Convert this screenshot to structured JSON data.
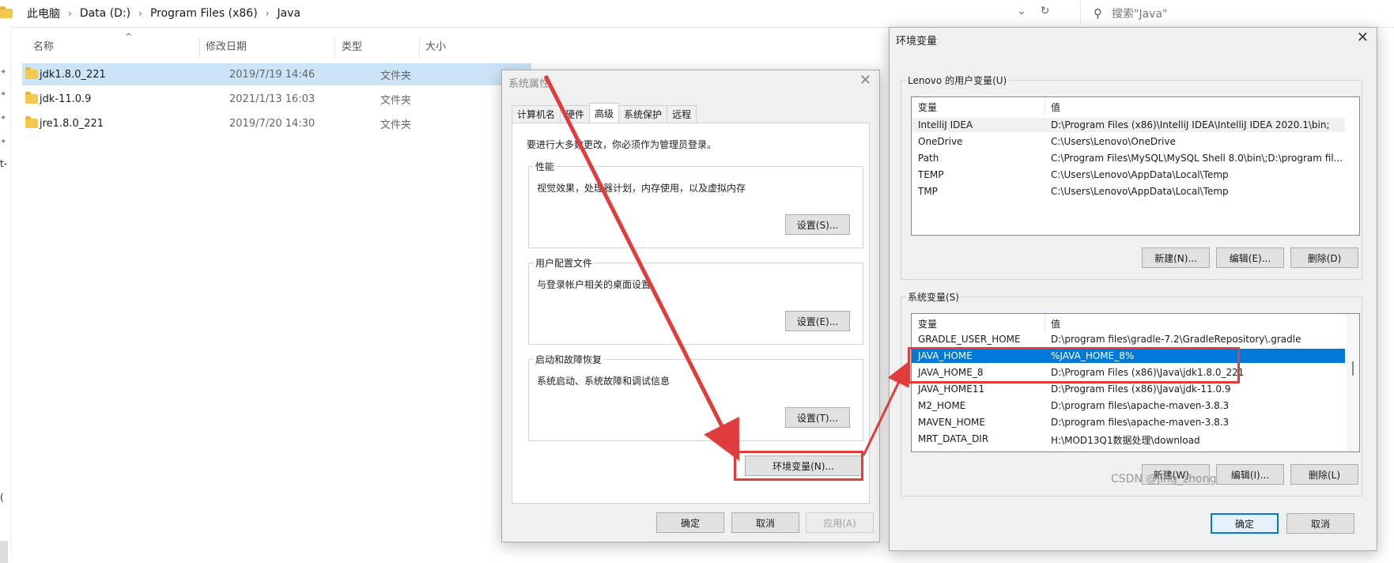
{
  "explorer": {
    "breadcrumbs": [
      "此电脑",
      "Data (D:)",
      "Program Files (x86)",
      "Java"
    ],
    "search_placeholder": "搜索\"Java\"",
    "columns": [
      "名称",
      "修改日期",
      "类型",
      "大小"
    ],
    "files": [
      {
        "name": "jdk1.8.0_221",
        "date": "2019/7/19 14:46",
        "type": "文件夹"
      },
      {
        "name": "jdk-11.0.9",
        "date": "2021/1/13 16:03",
        "type": "文件夹"
      },
      {
        "name": "jre1.8.0_221",
        "date": "2019/7/20 14:30",
        "type": "文件夹"
      }
    ],
    "leftnav_fragments": [
      "t-",
      "("
    ]
  },
  "system_properties": {
    "title": "系统属性",
    "tabs": [
      "计算机名",
      "硬件",
      "高级",
      "系统保护",
      "远程"
    ],
    "admin_note": "要进行大多数更改，你必须作为管理员登录。",
    "performance": {
      "title": "性能",
      "desc": "视觉效果，处理器计划，内存使用，以及虚拟内存",
      "button": "设置(S)..."
    },
    "user_profiles": {
      "title": "用户配置文件",
      "desc": "与登录帐户相关的桌面设置",
      "button": "设置(E)..."
    },
    "startup": {
      "title": "启动和故障恢复",
      "desc": "系统启动、系统故障和调试信息",
      "button": "设置(T)..."
    },
    "env_button": "环境变量(N)...",
    "ok": "确定",
    "cancel": "取消",
    "apply": "应用(A)"
  },
  "env_vars": {
    "title": "环境变量",
    "user_group": "Lenovo 的用户变量(U)",
    "col_var": "变量",
    "col_val": "值",
    "user_vars": [
      {
        "name": "IntelliJ IDEA",
        "value": "D:\\Program Files (x86)\\IntelliJ IDEA\\IntelliJ IDEA 2020.1\\bin;"
      },
      {
        "name": "OneDrive",
        "value": "C:\\Users\\Lenovo\\OneDrive"
      },
      {
        "name": "Path",
        "value": "C:\\Program Files\\MySQL\\MySQL Shell 8.0\\bin\\;D:\\program fil..."
      },
      {
        "name": "TEMP",
        "value": "C:\\Users\\Lenovo\\AppData\\Local\\Temp"
      },
      {
        "name": "TMP",
        "value": "C:\\Users\\Lenovo\\AppData\\Local\\Temp"
      }
    ],
    "user_buttons": {
      "new": "新建(N)...",
      "edit": "编辑(E)...",
      "delete": "删除(D)"
    },
    "system_group": "系统变量(S)",
    "system_vars": [
      {
        "name": "GRADLE_USER_HOME",
        "value": "D:\\program files\\gradle-7.2\\GradleRepository\\.gradle"
      },
      {
        "name": "JAVA_HOME",
        "value": "%JAVA_HOME_8%"
      },
      {
        "name": "JAVA_HOME_8",
        "value": "D:\\Program Files (x86)\\Java\\jdk1.8.0_221"
      },
      {
        "name": "JAVA_HOME11",
        "value": "D:\\Program Files (x86)\\Java\\jdk-11.0.9"
      },
      {
        "name": "M2_HOME",
        "value": "D:\\program files\\apache-maven-3.8.3"
      },
      {
        "name": "MAVEN_HOME",
        "value": "D:\\program files\\apache-maven-3.8.3"
      },
      {
        "name": "MRT_DATA_DIR",
        "value": "H:\\MOD13Q1数据处理\\download"
      }
    ],
    "system_buttons": {
      "new": "新建(W)...",
      "edit": "编辑(I)...",
      "delete": "删除(L)"
    },
    "ok": "确定",
    "cancel": "取消"
  },
  "annotation_color": "#e03c3c",
  "selection_color": "#0078d7",
  "watermark": "CSDN @jing_zhong"
}
